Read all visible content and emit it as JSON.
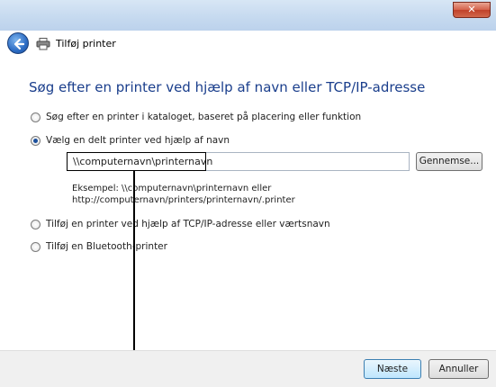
{
  "window": {
    "title": "Tilføj printer",
    "close_label": "✕"
  },
  "heading": "Søg efter en printer ved hjælp af navn eller TCP/IP-adresse",
  "options": [
    {
      "label": "Søg efter en printer i kataloget, baseret på placering eller funktion",
      "checked": false
    },
    {
      "label": "Vælg en delt printer ved hjælp af navn",
      "checked": true
    },
    {
      "label": "Tilføj en printer ved hjælp af TCP/IP-adresse eller værtsnavn",
      "checked": false
    },
    {
      "label": "Tilføj en Bluetooth-printer",
      "checked": false
    }
  ],
  "shared_printer": {
    "value": "\\\\computernavn\\printernavn",
    "browse_label": "Gennemse...",
    "example_line1": "Eksempel: \\\\computernavn\\printernavn eller",
    "example_line2": "http://computernavn/printers/printernavn/.printer"
  },
  "footer": {
    "next_label": "Næste",
    "cancel_label": "Annuller"
  },
  "colors": {
    "heading": "#1a3e8c",
    "titlebar": "#c5d9ef",
    "close": "#c0412a"
  }
}
